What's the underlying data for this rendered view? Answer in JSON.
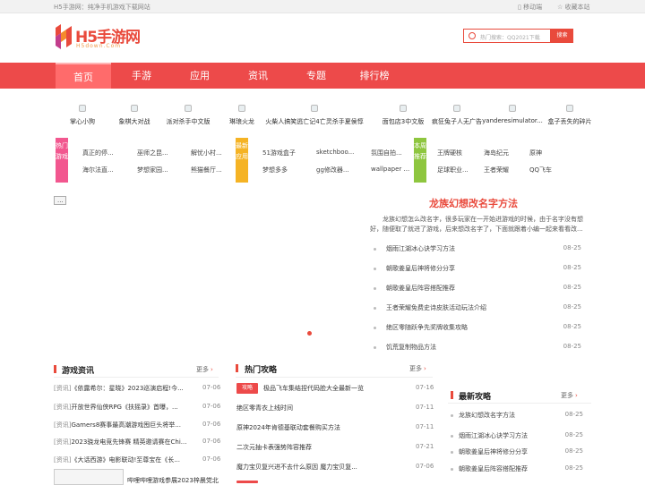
{
  "topbar": {
    "left_text": "H5手游网：纯净手机游戏下载网站",
    "mobile_link": "移动端",
    "bookmark_link": "收藏本站",
    "mobile_icon": "phone-icon",
    "bookmark_icon": "star-icon"
  },
  "header": {
    "logo_text": "H5手游网",
    "logo_sub": "H5down.Com",
    "search_placeholder": "QQ2021下载",
    "search_hint": "热门搜索：",
    "search_button": "搜索"
  },
  "nav": {
    "items": [
      "首页",
      "手游",
      "应用",
      "资讯",
      "专题",
      "排行榜"
    ]
  },
  "icon_row": [
    "掌心小狗",
    "象棋大对战",
    "派对杀手中文版",
    "琳琅火龙",
    "火柴人搞笑逃亡记4亡灵杀手夏侯惇",
    "面包店3中文版",
    "疯狂兔子人无广告",
    "yanderesimulator...",
    "盒子丢失的碎片"
  ],
  "hot_games": {
    "label": "热门游戏",
    "items": [
      "真正的停...",
      "巫师之昆...",
      "解忧小村...",
      "海尔法直...",
      "梦想家园...",
      "熊猫餐厅..."
    ]
  },
  "new_apps": {
    "label": "最新应用",
    "items": [
      "51游戏盒子",
      "sketchboo...",
      "氛围自拍...",
      "梦想多多",
      "gg修改器...",
      "wallpaper ..."
    ]
  },
  "weekly": {
    "label": "本周推荐",
    "items": [
      "王牌硬核",
      "海岛纪元",
      "原神",
      "足球职业...",
      "王者荣耀",
      "QQ飞车"
    ]
  },
  "banner": {
    "broken_image_text": "..."
  },
  "featured": {
    "title": "龙族幻想改名字方法",
    "description": "龙族幻想怎么改名字，很多玩家在一开始进游戏的时候，由于名字没有想好，随便取了就进了游戏，后来想改名字了，下面就跟着小编一起来看看改...",
    "news": [
      {
        "title": "烟雨江湖冰心诀学习方法",
        "date": "08-25"
      },
      {
        "title": "朝歌姜皇后神将修分分享",
        "date": "08-25"
      },
      {
        "title": "朝歌姜皇后阵容搭配推荐",
        "date": "08-25"
      },
      {
        "title": "王者荣耀免费史诗皮肤活动玩法介绍",
        "date": "08-25"
      },
      {
        "title": "绝区零随跃争先奖牌收集攻略",
        "date": "08-25"
      },
      {
        "title": "饥荒复制物品方法",
        "date": "08-25"
      }
    ]
  },
  "game_news": {
    "title": "游戏资讯",
    "more": "更多",
    "rows": [
      {
        "tag": "[资讯]",
        "title": "《依露希尔：星晓》2023巡演启程!今...",
        "date": "07-06"
      },
      {
        "tag": "[资讯]",
        "title": "开放世界仙侠RPG《扶摇录》首曝，...",
        "date": "07-06"
      },
      {
        "tag": "[资讯]",
        "title": "Gamers8赛事最高潮游戏囤巨头将举...",
        "date": "07-06"
      },
      {
        "tag": "[资讯]",
        "title": "2023骁龙电竞先锋赛 精英邀请赛在Chi...",
        "date": "07-06"
      },
      {
        "tag": "[资讯]",
        "title": "《大话西游》电影联动!至尊宝在《长...",
        "date": "07-06"
      }
    ],
    "bottom_text": "哔哩哔哩游戏参展2023梓晨党北"
  },
  "hot_guides": {
    "title": "热门攻略",
    "more": "更多",
    "badge": "攻略",
    "rows": [
      {
        "title": "极品飞车集结捏代码脸大全最新一览",
        "date": "07-16"
      },
      {
        "title": "绝区零青衣上线时间",
        "date": "07-11"
      },
      {
        "title": "原神2024年肯德基联动套餐购买方法",
        "date": "07-11"
      },
      {
        "title": "二次元抽卡表强势阵容推荐",
        "date": "07-21"
      },
      {
        "title": "魔力宝贝复兴进不去什么原因 魔力宝贝复...",
        "date": "07-06"
      }
    ]
  },
  "latest_guides": {
    "title": "最新攻略",
    "more": "更多",
    "rows": [
      {
        "title": "龙族幻想改名字方法",
        "date": "08-25"
      },
      {
        "title": "烟雨江湖冰心诀学习方法",
        "date": "08-25"
      },
      {
        "title": "朝歌姜皇后神将修分分享",
        "date": "08-25"
      },
      {
        "title": "朝歌姜皇后阵容搭配推荐",
        "date": "08-25"
      }
    ]
  },
  "colors": {
    "accent": "#ed4a4a",
    "hot": "#f2578f",
    "new": "#f5b324",
    "week": "#8ec63f"
  }
}
